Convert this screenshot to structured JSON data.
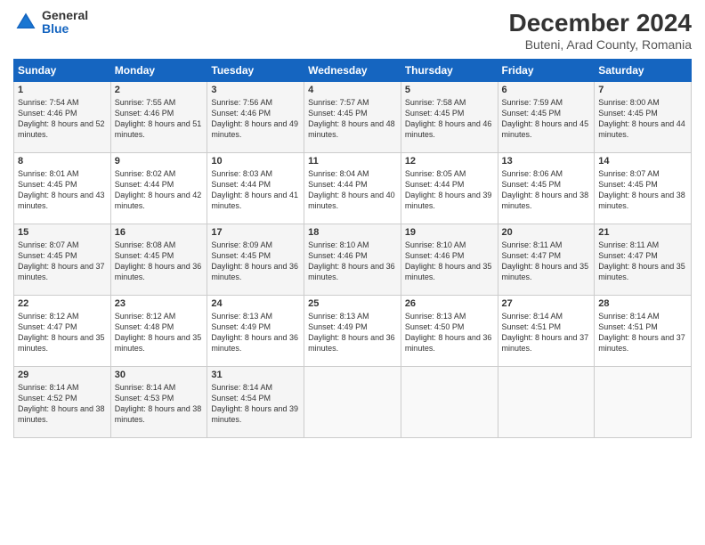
{
  "logo": {
    "general": "General",
    "blue": "Blue"
  },
  "header": {
    "title": "December 2024",
    "subtitle": "Buteni, Arad County, Romania"
  },
  "days_of_week": [
    "Sunday",
    "Monday",
    "Tuesday",
    "Wednesday",
    "Thursday",
    "Friday",
    "Saturday"
  ],
  "weeks": [
    [
      {
        "day": "1",
        "sunrise": "Sunrise: 7:54 AM",
        "sunset": "Sunset: 4:46 PM",
        "daylight": "Daylight: 8 hours and 52 minutes."
      },
      {
        "day": "2",
        "sunrise": "Sunrise: 7:55 AM",
        "sunset": "Sunset: 4:46 PM",
        "daylight": "Daylight: 8 hours and 51 minutes."
      },
      {
        "day": "3",
        "sunrise": "Sunrise: 7:56 AM",
        "sunset": "Sunset: 4:46 PM",
        "daylight": "Daylight: 8 hours and 49 minutes."
      },
      {
        "day": "4",
        "sunrise": "Sunrise: 7:57 AM",
        "sunset": "Sunset: 4:45 PM",
        "daylight": "Daylight: 8 hours and 48 minutes."
      },
      {
        "day": "5",
        "sunrise": "Sunrise: 7:58 AM",
        "sunset": "Sunset: 4:45 PM",
        "daylight": "Daylight: 8 hours and 46 minutes."
      },
      {
        "day": "6",
        "sunrise": "Sunrise: 7:59 AM",
        "sunset": "Sunset: 4:45 PM",
        "daylight": "Daylight: 8 hours and 45 minutes."
      },
      {
        "day": "7",
        "sunrise": "Sunrise: 8:00 AM",
        "sunset": "Sunset: 4:45 PM",
        "daylight": "Daylight: 8 hours and 44 minutes."
      }
    ],
    [
      {
        "day": "8",
        "sunrise": "Sunrise: 8:01 AM",
        "sunset": "Sunset: 4:45 PM",
        "daylight": "Daylight: 8 hours and 43 minutes."
      },
      {
        "day": "9",
        "sunrise": "Sunrise: 8:02 AM",
        "sunset": "Sunset: 4:44 PM",
        "daylight": "Daylight: 8 hours and 42 minutes."
      },
      {
        "day": "10",
        "sunrise": "Sunrise: 8:03 AM",
        "sunset": "Sunset: 4:44 PM",
        "daylight": "Daylight: 8 hours and 41 minutes."
      },
      {
        "day": "11",
        "sunrise": "Sunrise: 8:04 AM",
        "sunset": "Sunset: 4:44 PM",
        "daylight": "Daylight: 8 hours and 40 minutes."
      },
      {
        "day": "12",
        "sunrise": "Sunrise: 8:05 AM",
        "sunset": "Sunset: 4:44 PM",
        "daylight": "Daylight: 8 hours and 39 minutes."
      },
      {
        "day": "13",
        "sunrise": "Sunrise: 8:06 AM",
        "sunset": "Sunset: 4:45 PM",
        "daylight": "Daylight: 8 hours and 38 minutes."
      },
      {
        "day": "14",
        "sunrise": "Sunrise: 8:07 AM",
        "sunset": "Sunset: 4:45 PM",
        "daylight": "Daylight: 8 hours and 38 minutes."
      }
    ],
    [
      {
        "day": "15",
        "sunrise": "Sunrise: 8:07 AM",
        "sunset": "Sunset: 4:45 PM",
        "daylight": "Daylight: 8 hours and 37 minutes."
      },
      {
        "day": "16",
        "sunrise": "Sunrise: 8:08 AM",
        "sunset": "Sunset: 4:45 PM",
        "daylight": "Daylight: 8 hours and 36 minutes."
      },
      {
        "day": "17",
        "sunrise": "Sunrise: 8:09 AM",
        "sunset": "Sunset: 4:45 PM",
        "daylight": "Daylight: 8 hours and 36 minutes."
      },
      {
        "day": "18",
        "sunrise": "Sunrise: 8:10 AM",
        "sunset": "Sunset: 4:46 PM",
        "daylight": "Daylight: 8 hours and 36 minutes."
      },
      {
        "day": "19",
        "sunrise": "Sunrise: 8:10 AM",
        "sunset": "Sunset: 4:46 PM",
        "daylight": "Daylight: 8 hours and 35 minutes."
      },
      {
        "day": "20",
        "sunrise": "Sunrise: 8:11 AM",
        "sunset": "Sunset: 4:47 PM",
        "daylight": "Daylight: 8 hours and 35 minutes."
      },
      {
        "day": "21",
        "sunrise": "Sunrise: 8:11 AM",
        "sunset": "Sunset: 4:47 PM",
        "daylight": "Daylight: 8 hours and 35 minutes."
      }
    ],
    [
      {
        "day": "22",
        "sunrise": "Sunrise: 8:12 AM",
        "sunset": "Sunset: 4:47 PM",
        "daylight": "Daylight: 8 hours and 35 minutes."
      },
      {
        "day": "23",
        "sunrise": "Sunrise: 8:12 AM",
        "sunset": "Sunset: 4:48 PM",
        "daylight": "Daylight: 8 hours and 35 minutes."
      },
      {
        "day": "24",
        "sunrise": "Sunrise: 8:13 AM",
        "sunset": "Sunset: 4:49 PM",
        "daylight": "Daylight: 8 hours and 36 minutes."
      },
      {
        "day": "25",
        "sunrise": "Sunrise: 8:13 AM",
        "sunset": "Sunset: 4:49 PM",
        "daylight": "Daylight: 8 hours and 36 minutes."
      },
      {
        "day": "26",
        "sunrise": "Sunrise: 8:13 AM",
        "sunset": "Sunset: 4:50 PM",
        "daylight": "Daylight: 8 hours and 36 minutes."
      },
      {
        "day": "27",
        "sunrise": "Sunrise: 8:14 AM",
        "sunset": "Sunset: 4:51 PM",
        "daylight": "Daylight: 8 hours and 37 minutes."
      },
      {
        "day": "28",
        "sunrise": "Sunrise: 8:14 AM",
        "sunset": "Sunset: 4:51 PM",
        "daylight": "Daylight: 8 hours and 37 minutes."
      }
    ],
    [
      {
        "day": "29",
        "sunrise": "Sunrise: 8:14 AM",
        "sunset": "Sunset: 4:52 PM",
        "daylight": "Daylight: 8 hours and 38 minutes."
      },
      {
        "day": "30",
        "sunrise": "Sunrise: 8:14 AM",
        "sunset": "Sunset: 4:53 PM",
        "daylight": "Daylight: 8 hours and 38 minutes."
      },
      {
        "day": "31",
        "sunrise": "Sunrise: 8:14 AM",
        "sunset": "Sunset: 4:54 PM",
        "daylight": "Daylight: 8 hours and 39 minutes."
      },
      null,
      null,
      null,
      null
    ]
  ]
}
